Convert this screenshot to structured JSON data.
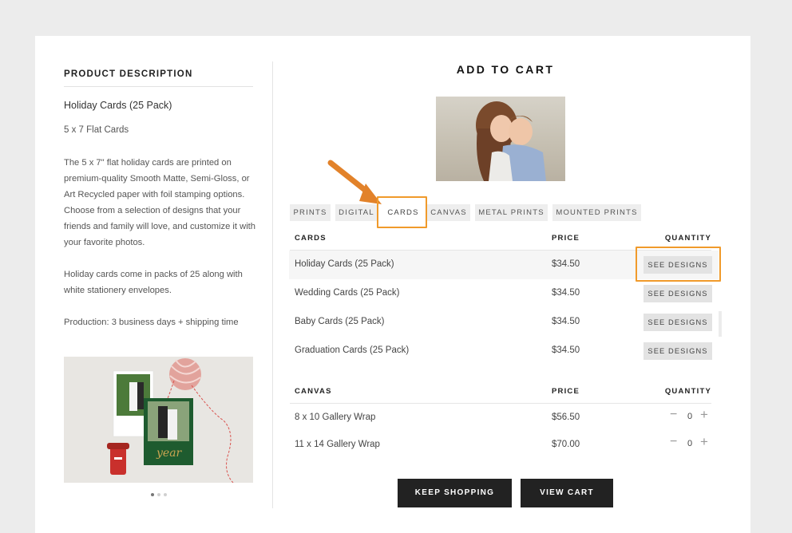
{
  "description": {
    "heading": "PRODUCT DESCRIPTION",
    "title": "Holiday Cards (25 Pack)",
    "size": "5 x 7 Flat Cards",
    "paragraph1": "The 5 x 7\" flat holiday cards are printed on premium-quality Smooth Matte, Semi-Gloss, or Art Recycled paper with foil stamping options. Choose from a selection of designs that your friends and family will love, and customize it with your favorite photos.",
    "paragraph2": "Holiday cards come in packs of 25 along with white stationery envelopes.",
    "production": "Production: 3 business days + shipping time",
    "card_foil_text": "year"
  },
  "cart": {
    "heading": "ADD TO CART",
    "tabs": [
      "PRINTS",
      "DIGITAL",
      "CARDS",
      "CANVAS",
      "METAL PRINTS",
      "MOUNTED PRINTS"
    ],
    "active_tab": "CARDS",
    "cards_section": {
      "header": {
        "name": "CARDS",
        "price": "PRICE",
        "quantity": "QUANTITY"
      },
      "button_label": "SEE DESIGNS",
      "rows": [
        {
          "name": "Holiday Cards (25 Pack)",
          "price": "$34.50"
        },
        {
          "name": "Wedding Cards (25 Pack)",
          "price": "$34.50"
        },
        {
          "name": "Baby Cards (25 Pack)",
          "price": "$34.50"
        },
        {
          "name": "Graduation Cards (25 Pack)",
          "price": "$34.50"
        }
      ]
    },
    "canvas_section": {
      "header": {
        "name": "CANVAS",
        "price": "PRICE",
        "quantity": "QUANTITY"
      },
      "rows": [
        {
          "name": "8 x 10 Gallery Wrap",
          "price": "$56.50",
          "qty": "0"
        },
        {
          "name": "11 x 14 Gallery Wrap",
          "price": "$70.00",
          "qty": "0"
        }
      ]
    },
    "buttons": {
      "keep_shopping": "KEEP SHOPPING",
      "view_cart": "VIEW CART"
    }
  },
  "icons": {
    "minus": "minus-icon",
    "plus": "plus-icon",
    "annotation_arrow": "arrow-icon"
  },
  "colors": {
    "highlight": "#f09a2b",
    "dark_button": "#222222",
    "shaded_row": "#f6f6f6",
    "tab_bg": "#eeeeee",
    "designs_button": "#e3e3e3"
  }
}
